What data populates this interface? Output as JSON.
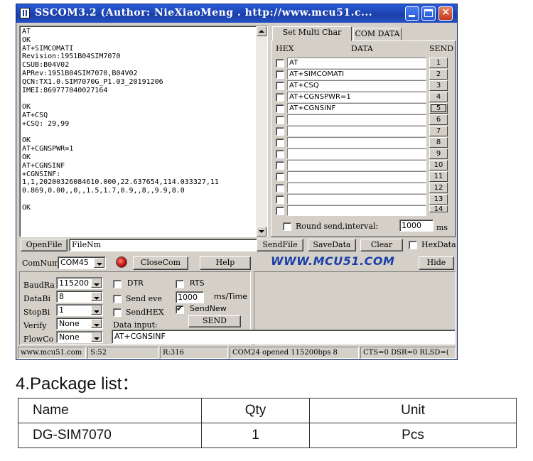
{
  "window": {
    "title": "SSCOM3.2 (Author: NieXiaoMeng .  http://www.mcu51.c...",
    "colors": {
      "titlebar": "#1a3fa8",
      "face": "#d4d0c8",
      "brand_blue": "#1a3fa8",
      "brand_red": "#e02010"
    }
  },
  "receive": {
    "text": "AT\nOK\nAT+SIMCOMATI\nRevision:1951B04SIM7070\nCSUB:B04V02\nAPRev:1951B04SIM7070,B04V02\nQCN:TX1.0.SIM7070G_P1.03_20191206\nIMEI:869777040027164\n\nOK\nAT+CSQ\n+CSQ: 29,99\n\nOK\nAT+CGNSPWR=1\nOK\nAT+CGNSINF\n+CGNSINF:\n1,1,20200326084610.000,22.637654,114.033327,11\n0.869,0.00,,0,,1.5,1.7,0.9,,8,,9.9,8.0\n\nOK"
  },
  "multi": {
    "tabs": [
      "Set Multi Char",
      "COM DATA"
    ],
    "headers": {
      "hex": "HEX",
      "data": "DATA",
      "send": "SEND"
    },
    "rows": [
      {
        "data": "AT",
        "num": "1"
      },
      {
        "data": "AT+SIMCOMATI",
        "num": "2"
      },
      {
        "data": "AT+CSQ",
        "num": "3"
      },
      {
        "data": "AT+CGNSPWR=1",
        "num": "4"
      },
      {
        "data": "AT+CGNSINF",
        "num": "5"
      },
      {
        "data": "",
        "num": "6"
      },
      {
        "data": "",
        "num": "7"
      },
      {
        "data": "",
        "num": "8"
      },
      {
        "data": "",
        "num": "9"
      },
      {
        "data": "",
        "num": "10"
      },
      {
        "data": "",
        "num": "11"
      },
      {
        "data": "",
        "num": "12"
      },
      {
        "data": "",
        "num": "13"
      },
      {
        "data": "",
        "num": "14"
      }
    ],
    "round_send_label": "Round send,interval:",
    "interval": "1000",
    "interval_unit": "ms"
  },
  "file": {
    "open_label": "OpenFile",
    "filename": "FileNm",
    "sendfile_label": "SendFile",
    "savedata_label": "SaveData",
    "clear_label": "Clear",
    "hexdata_label": "HexData"
  },
  "port": {
    "comnum_label": "ComNum",
    "comnum": "COM45",
    "close_label": "CloseCom",
    "help_label": "Help",
    "brand": "WWW.MCU51.COM",
    "hide_label": "Hide"
  },
  "settings": {
    "baud_label": "BaudRa",
    "baud": "115200",
    "databits_label": "DataBi",
    "databits": "8",
    "stopbits_label": "StopBi",
    "stopbits": "1",
    "verify_label": "Verify",
    "verify": "None",
    "flow_label": "FlowCo",
    "flow": "None",
    "dtr_label": "DTR",
    "rts_label": "RTS",
    "send_every_label": "Send eve",
    "send_every_value": "1000",
    "send_every_unit": "ms/Time",
    "sendhex_label": "SendHEX",
    "sendnew_label": "SendNew",
    "data_input_label": "Data input:",
    "send_label": "SEND",
    "data_input": "AT+CGNSINF"
  },
  "status": {
    "site": "www.mcu51.com",
    "s": "S:52",
    "r": "R:316",
    "com": "COM24 opened 115200bps  8",
    "lines": "CTS=0 DSR=0 RLSD=("
  },
  "package": {
    "title": "4.Package list：",
    "headers": [
      "Name",
      "Qty",
      "Unit"
    ],
    "rows": [
      [
        "DG-SIM7070",
        "1",
        "Pcs"
      ]
    ]
  }
}
